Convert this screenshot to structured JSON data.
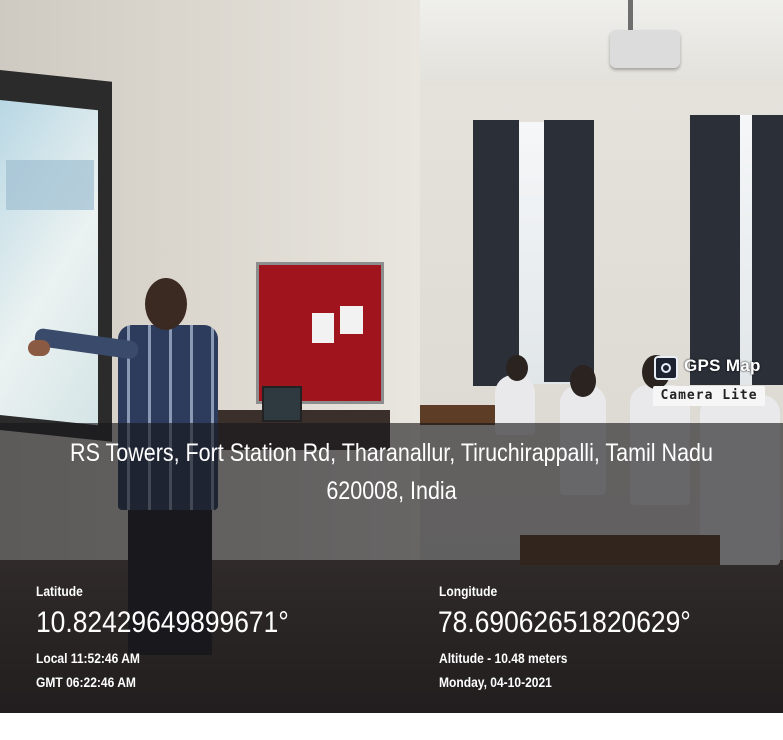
{
  "watermark": {
    "title": "GPS Map",
    "subtitle": "Camera Lite",
    "icon": "camera-icon"
  },
  "address": {
    "line1": "RS Towers, Fort Station Rd, Tharanallur, Tiruchirappalli, Tamil Nadu",
    "line2": "620008, India"
  },
  "latitude": {
    "label": "Latitude",
    "value": "10.82429649899671°"
  },
  "longitude": {
    "label": "Longitude",
    "value": "78.69062651820629°"
  },
  "local_time": "Local 11:52:46 AM",
  "gmt_time": "GMT 06:22:46 AM",
  "altitude": "Altitude - 10.48 meters",
  "date": "Monday, 04-10-2021"
}
